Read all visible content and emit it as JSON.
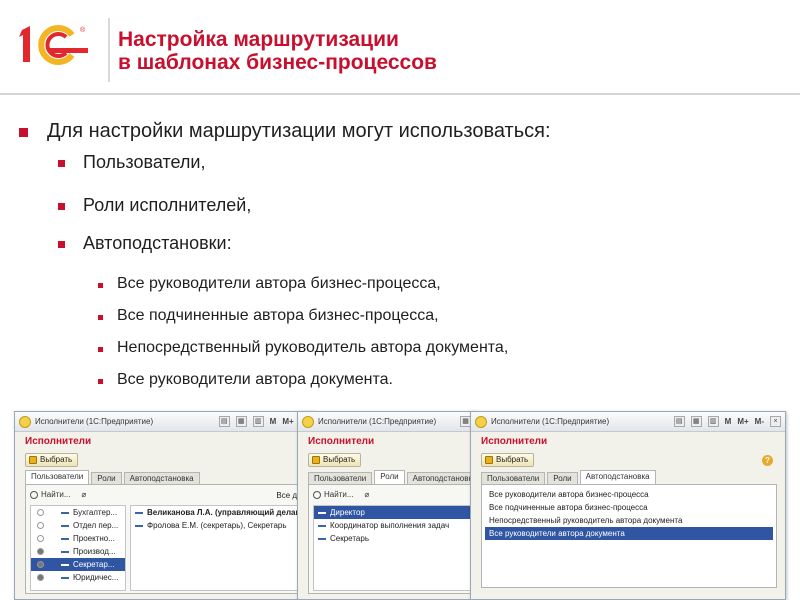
{
  "header": {
    "logo_text": "1С",
    "title_line1": "Настройка маршрутизации",
    "title_line2": "в шаблонах бизнес-процессов"
  },
  "colors": {
    "accent": "#c8102e",
    "selection": "#2f55a3"
  },
  "bullets": {
    "level1": "Для настройки маршрутизации могут использоваться:",
    "level2": [
      "Пользователи,",
      "Роли исполнителей,",
      "Автоподстановки:"
    ],
    "level3": [
      "Все руководители автора бизнес-процесса,",
      "Все подчиненные  автора бизнес-процесса,",
      "Непосредственный  руководитель автора документа,",
      "Все руководители автора документа."
    ]
  },
  "common": {
    "window_title": "Исполнители  (1С:Предприятие)",
    "form_title": "Исполнители",
    "choose_button": "Выбрать",
    "tabs": [
      "Пользователи",
      "Роли",
      "Автоподстановка"
    ],
    "search_label": "Найти...",
    "tb_m": "M",
    "tb_mplus": "M+",
    "tb_mminus": "M-",
    "tb_close": "×",
    "help": "?"
  },
  "window1": {
    "tree": [
      {
        "label": "Бухгалтер...",
        "radio": "off"
      },
      {
        "label": "Отдел пер...",
        "radio": "off"
      },
      {
        "label": "Проектно...",
        "radio": "off"
      },
      {
        "label": "Производ...",
        "radio": "on"
      },
      {
        "label": "Секретар...",
        "radio": "on",
        "selected": true
      },
      {
        "label": "Юридичес...",
        "radio": "on"
      }
    ],
    "users": [
      "Великанова Л.А. (управляющий делами),",
      "Фролова Е.М. (секретарь), Секретарь"
    ],
    "all_label": "Все дейс"
  },
  "window2": {
    "roles": [
      "Директор",
      "Координатор выполнения задач",
      "Секретарь"
    ]
  },
  "window3": {
    "items": [
      "Все руководители автора бизнес-процесса",
      "Все подчиненные автора бизнес-процесса",
      "Непосредственный руководитель автора документа",
      "Все руководители автора документа"
    ]
  }
}
